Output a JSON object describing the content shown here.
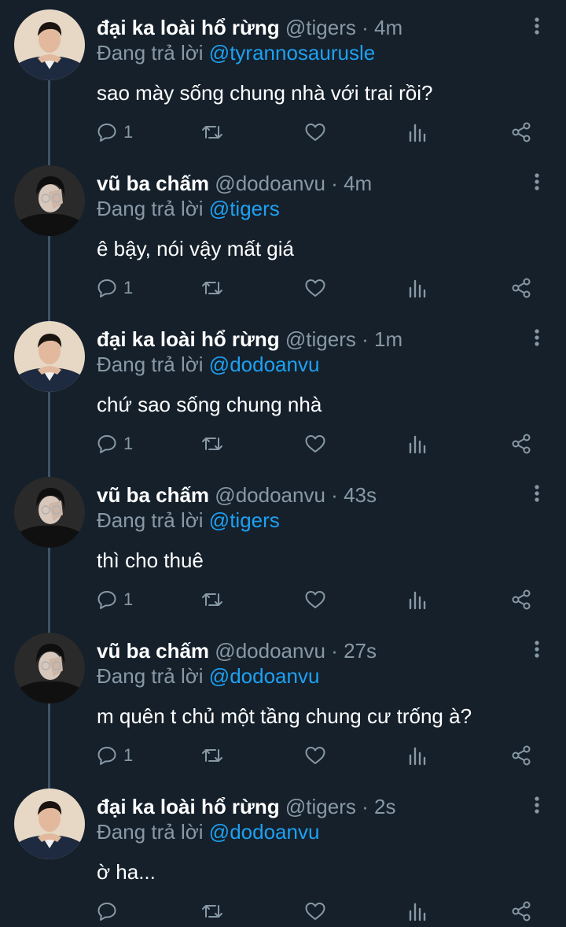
{
  "colors": {
    "background": "#15202b",
    "text_primary": "#ffffff",
    "text_secondary": "#8899a6",
    "mention": "#1da1f2",
    "thread_line": "#3d5466"
  },
  "icons": {
    "reply": "reply-icon",
    "retweet": "retweet-icon",
    "like": "heart-icon",
    "analytics": "analytics-icon",
    "share": "share-icon",
    "more": "more-vertical-icon"
  },
  "reply_prefix": "Đang trả lời",
  "tweets": [
    {
      "name": "đại ka loài hổ rừng",
      "handle": "@tigers",
      "separator": "·",
      "time": "4m",
      "replying_to": "@tyrannosaurusle",
      "text": "sao mày sống chung nhà với trai rồi?",
      "reply_count": "1"
    },
    {
      "name": "vũ ba chấm",
      "handle": "@dodoanvu",
      "separator": "·",
      "time": "4m",
      "replying_to": "@tigers",
      "text": "ê bậy, nói vậy mất giá",
      "reply_count": "1"
    },
    {
      "name": "đại ka loài hổ rừng",
      "handle": "@tigers",
      "separator": "·",
      "time": "1m",
      "replying_to": "@dodoanvu",
      "text": "chứ sao sống chung nhà",
      "reply_count": "1"
    },
    {
      "name": "vũ ba chấm",
      "handle": "@dodoanvu",
      "separator": "·",
      "time": "43s",
      "replying_to": "@tigers",
      "text": "thì cho thuê",
      "reply_count": "1"
    },
    {
      "name": "vũ ba chấm",
      "handle": "@dodoanvu",
      "separator": "·",
      "time": "27s",
      "replying_to": "@dodoanvu",
      "text": "m quên t chủ một tầng chung cư trống à?",
      "reply_count": "1"
    },
    {
      "name": "đại ka loài hổ rừng",
      "handle": "@tigers",
      "separator": "·",
      "time": "2s",
      "replying_to": "@dodoanvu",
      "text": "ờ ha...",
      "reply_count": ""
    }
  ]
}
